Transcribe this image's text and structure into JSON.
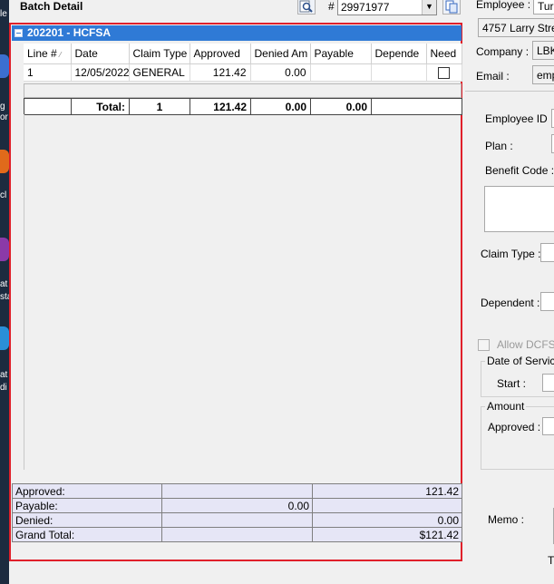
{
  "header": {
    "title": "Batch Detail",
    "hash": "#",
    "batch_number": "29971977"
  },
  "group": {
    "label": "202201 - HCFSA"
  },
  "grid": {
    "columns": [
      "Line #",
      "Date",
      "Claim Type",
      "Approved",
      "Denied Am",
      "Payable",
      "Depende",
      "Need"
    ],
    "rows": [
      {
        "line": "1",
        "date": "12/05/2022",
        "claim_type": "GENERAL",
        "approved": "121.42",
        "denied": "0.00",
        "payable": "",
        "dependent": "",
        "need": false
      }
    ],
    "totals": {
      "label": "Total:",
      "count": "1",
      "approved": "121.42",
      "denied": "0.00",
      "payable": "0.00"
    }
  },
  "summary": [
    {
      "label": "Approved:",
      "col2": "",
      "col3": "121.42"
    },
    {
      "label": "Payable:",
      "col2": "0.00",
      "col3": ""
    },
    {
      "label": "Denied:",
      "col2": "",
      "col3": "0.00"
    },
    {
      "label": "Grand Total:",
      "col2": "",
      "col3": "$121.42"
    }
  ],
  "form": {
    "employee_label": "Employee :",
    "employee_value": "Tur",
    "address_value": "4757 Larry Stree",
    "company_label": "Company :",
    "company_value": "LBK",
    "email_label": "Email :",
    "email_value": "emp",
    "employee_id_label": "Employee ID :",
    "plan_label": "Plan :",
    "benefit_code_label": "Benefit Code :",
    "claim_type_label": "Claim Type :",
    "dependent_label": "Dependent :",
    "allow_label": "Allow DCFSA",
    "date_of_service_label": "Date of Service",
    "start_label": "Start :",
    "amount_label": "Amount",
    "approved_label": "Approved :",
    "memo_label": "Memo :",
    "trailing_text": "T"
  },
  "taskbar": {
    "tile_texts": [
      "le",
      "g",
      "or",
      "cl",
      "at",
      "sta",
      "at",
      "di"
    ]
  }
}
